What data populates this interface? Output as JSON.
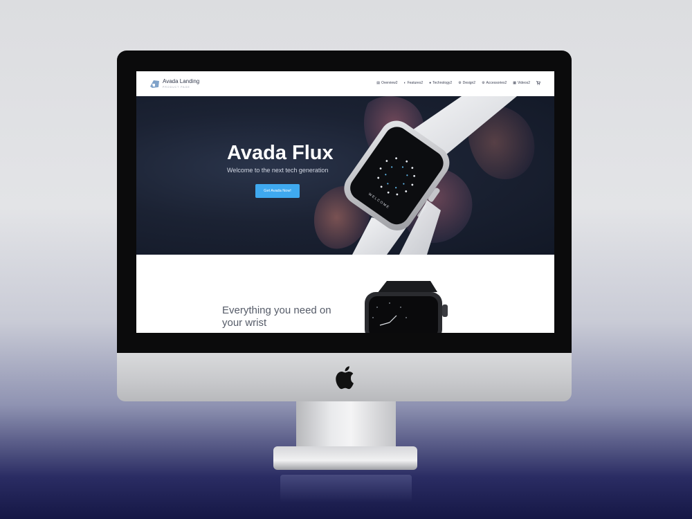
{
  "site": {
    "logo_title": "Avada Landing",
    "logo_subtitle": "PRODUCT PAGE"
  },
  "nav": {
    "items": [
      {
        "label": "Overview2",
        "icon": "overview-icon"
      },
      {
        "label": "Features2",
        "icon": "features-icon"
      },
      {
        "label": "Technology2",
        "icon": "technology-icon"
      },
      {
        "label": "Design2",
        "icon": "design-icon"
      },
      {
        "label": "Accessories2",
        "icon": "accessories-icon"
      },
      {
        "label": "Videos2",
        "icon": "videos-icon"
      }
    ],
    "cart_icon": "cart-icon"
  },
  "hero": {
    "title": "Avada Flux",
    "subtitle": "Welcome to the next tech generation",
    "cta_label": "Get Avada Now!",
    "watch_screen_text": "WELCOME"
  },
  "section2": {
    "heading_line1": "Everything you need on",
    "heading_line2": "your wrist"
  },
  "colors": {
    "accent": "#3fa9ef",
    "hero_bg": "#1b2233"
  }
}
